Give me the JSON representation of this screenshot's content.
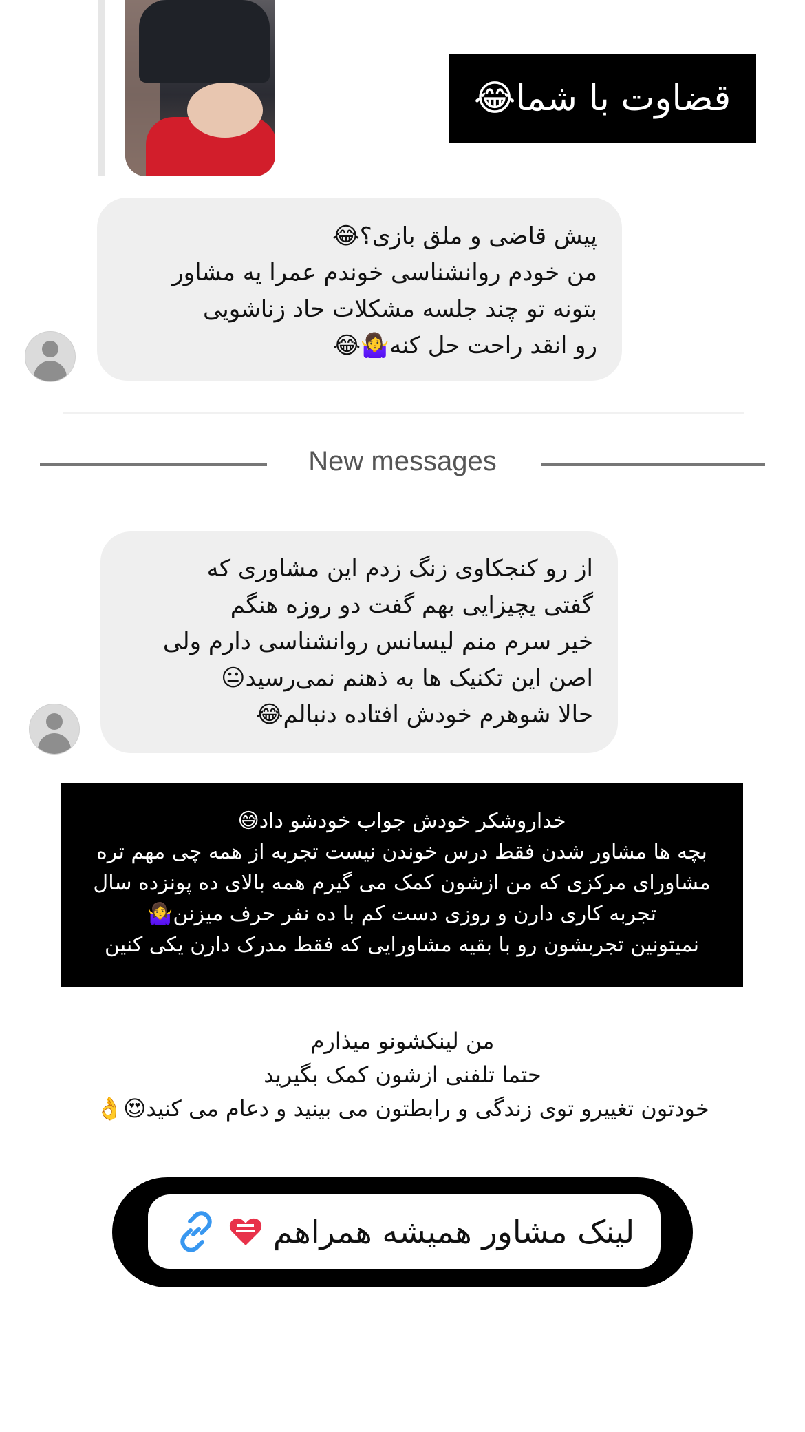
{
  "shared_photo": {
    "icon": "shared-photo"
  },
  "overlay_top": {
    "text": "قضاوت با شما😂"
  },
  "message_1": {
    "lines": [
      "پیش قاضی و ملق بازی؟😂",
      "من خودم روانشناسی خوندم عمرا یه مشاور",
      "بتونه تو چند جلسه مشکلات حاد زناشویی",
      "رو انقد راحت حل کنه🤷‍♀️😂"
    ]
  },
  "divider": {
    "label": "New messages"
  },
  "message_2": {
    "lines": [
      "از رو کنجکاوی زنگ زدم این مشاوری که",
      "گفتی یچیزایی بهم گفت دو روزه هنگم",
      "خیر سرم منم لیسانس روانشناسی دارم ولی",
      "اصن این تکنیک ها به ذهنم نمی‌رسید😐",
      "حالا شوهرم خودش افتاده دنبالم😂"
    ]
  },
  "overlay_middle": {
    "lines": [
      "خداروشکر خودش جواب خودشو داد😅",
      "بچه ها مشاور شدن فقط درس خوندن نیست تجربه از همه چی مهم تره",
      "مشاورای مرکزی که من ازشون کمک می گیرم همه بالای ده پونزده سال",
      "تجربه کاری دارن و روزی دست کم با ده نفر حرف میزنن🤷‍♀️",
      "نمیتونین تجربشون رو با بقیه مشاورایی که فقط مدرک دارن یکی کنین"
    ]
  },
  "caption": {
    "lines": [
      "من لینکشونو میذارم",
      "حتما تلفنی ازشون کمک بگیرید",
      "خودتون تغییرو توی زندگی و رابطتون می بینید و دعام می کنید😍👌"
    ]
  },
  "link_sticker": {
    "label": "لینک مشاور همیشه همراهم",
    "icon": "link-icon",
    "heart_icon": "heart-icon"
  },
  "colors": {
    "bubble": "#efefef",
    "overlay": "#000000",
    "divider": "#777777",
    "link_blue": "#3897f0"
  }
}
